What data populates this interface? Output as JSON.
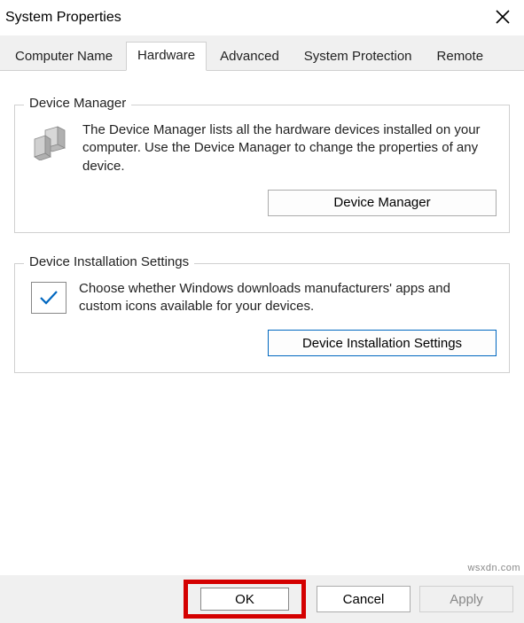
{
  "window": {
    "title": "System Properties"
  },
  "tabs": {
    "t0": "Computer Name",
    "t1": "Hardware",
    "t2": "Advanced",
    "t3": "System Protection",
    "t4": "Remote"
  },
  "device_manager": {
    "legend": "Device Manager",
    "desc": "The Device Manager lists all the hardware devices installed on your computer. Use the Device Manager to change the properties of any device.",
    "button": "Device Manager"
  },
  "install_settings": {
    "legend": "Device Installation Settings",
    "desc": "Choose whether Windows downloads manufacturers' apps and custom icons available for your devices.",
    "button": "Device Installation Settings"
  },
  "footer": {
    "ok": "OK",
    "cancel": "Cancel",
    "apply": "Apply"
  },
  "watermark": "wsxdn.com"
}
